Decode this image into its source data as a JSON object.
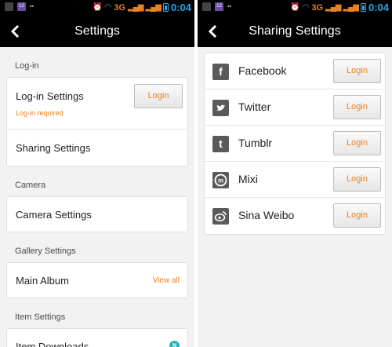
{
  "status_bar": {
    "network": "3G",
    "time": "0:04",
    "left_badge": "12"
  },
  "settings": {
    "title": "Settings",
    "sections": {
      "login_label": "Log-in",
      "camera_label": "Camera",
      "gallery_label": "Gallery Settings",
      "item_label": "Item Settings"
    },
    "login_settings": "Log-in Settings",
    "login_required": "Log-in required",
    "login_button": "Login",
    "sharing_settings": "Sharing Settings",
    "camera_settings": "Camera Settings",
    "main_album": "Main Album",
    "view_all": "View all",
    "item_downloads": "Item Downloads",
    "downloads_badge": "N"
  },
  "sharing": {
    "title": "Sharing Settings",
    "services": [
      {
        "name": "Facebook",
        "button": "Login",
        "icon": "facebook-icon"
      },
      {
        "name": "Twitter",
        "button": "Login",
        "icon": "twitter-icon"
      },
      {
        "name": "Tumblr",
        "button": "Login",
        "icon": "tumblr-icon"
      },
      {
        "name": "Mixi",
        "button": "Login",
        "icon": "mixi-icon"
      },
      {
        "name": "Sina Weibo",
        "button": "Login",
        "icon": "weibo-icon"
      }
    ]
  },
  "colors": {
    "accent": "#e8811f",
    "status_blue": "#2aa6e8",
    "badge_teal": "#24b3b0"
  }
}
